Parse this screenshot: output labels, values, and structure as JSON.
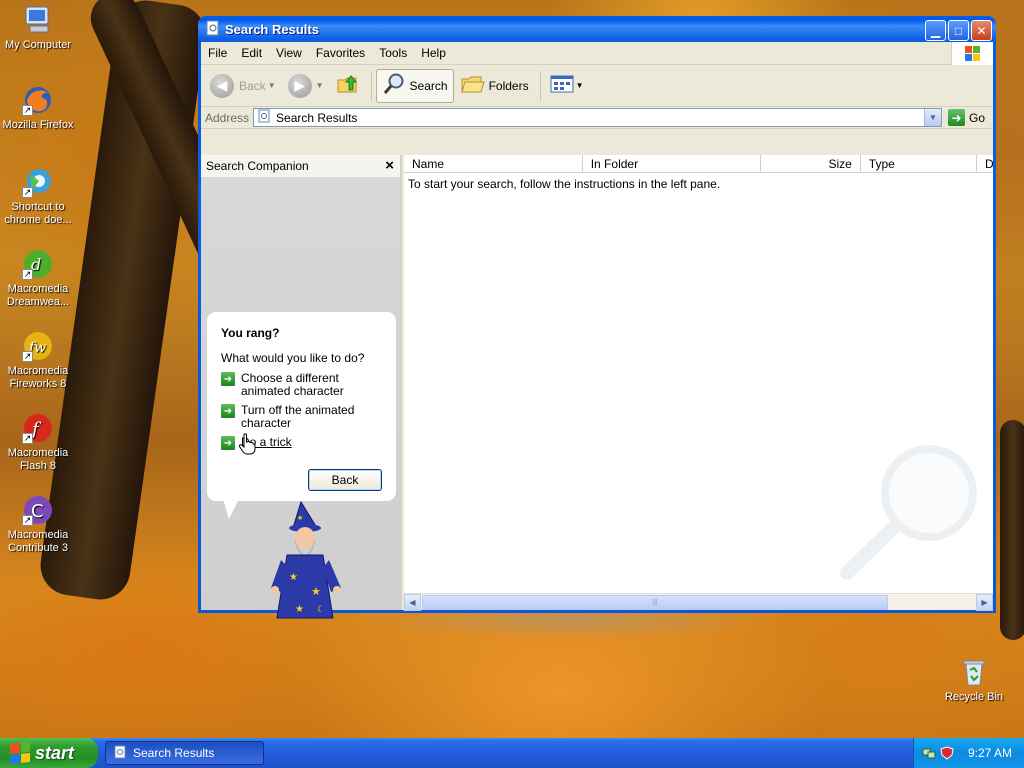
{
  "desktop": {
    "icons": [
      {
        "label": "My Computer"
      },
      {
        "label": "Mozilla Firefox"
      },
      {
        "label": "Shortcut to chrome doe..."
      },
      {
        "label": "Macromedia Dreamwea..."
      },
      {
        "label": "Macromedia Fireworks 8"
      },
      {
        "label": "Macromedia Flash 8"
      },
      {
        "label": "Macromedia Contribute 3"
      },
      {
        "label": "Recycle Bin"
      }
    ]
  },
  "window": {
    "title": "Search Results",
    "menu": [
      "File",
      "Edit",
      "View",
      "Favorites",
      "Tools",
      "Help"
    ],
    "toolbar": {
      "back_label": "Back",
      "search_label": "Search",
      "folders_label": "Folders"
    },
    "address": {
      "label": "Address",
      "value": "Search Results",
      "go_label": "Go"
    },
    "companion": {
      "title": "Search Companion",
      "balloon": {
        "heading": "You rang?",
        "question": "What would you like to do?",
        "options": [
          "Choose a different animated character",
          "Turn off the animated character",
          "Do a trick"
        ],
        "back_label": "Back"
      }
    },
    "results": {
      "columns": [
        "Name",
        "In Folder",
        "Size",
        "Type",
        "D"
      ],
      "message": "To start your search, follow the instructions in the left pane."
    }
  },
  "taskbar": {
    "start_label": "start",
    "task_label": "Search Results",
    "clock": "9:27 AM"
  },
  "colors": {
    "title_blue": "#0a58d8",
    "start_green": "#2f9a2f",
    "link_green": "#1a861a"
  }
}
